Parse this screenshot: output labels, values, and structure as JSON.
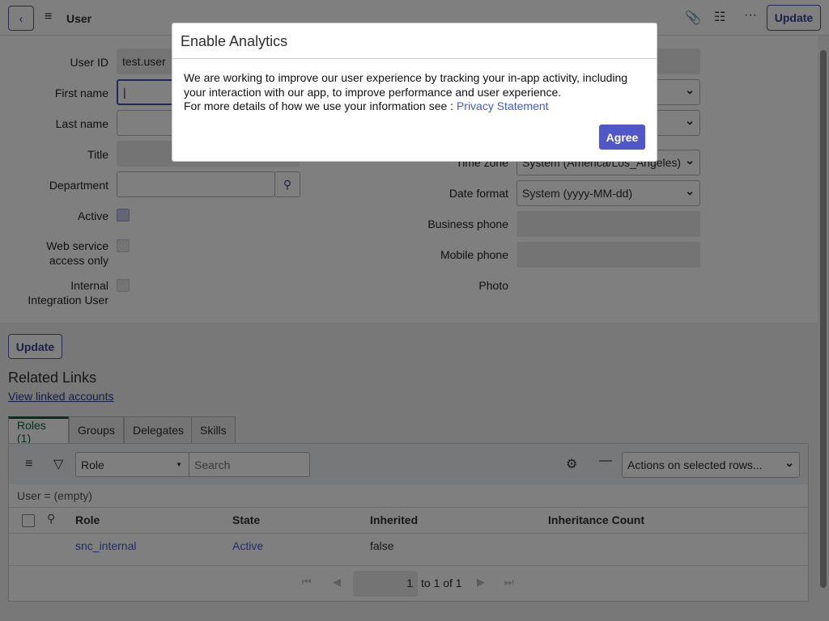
{
  "header": {
    "title": "User",
    "update_label": "Update"
  },
  "form": {
    "user_id_label": "User ID",
    "user_id_value": "test.user",
    "first_name_label": "First name",
    "last_name_label": "Last name",
    "title_label": "Title",
    "department_label": "Department",
    "active_label": "Active",
    "web_service_label_1": "Web service",
    "web_service_label_2": "access only",
    "internal_label_1": "Internal",
    "internal_label_2": "Integration User",
    "time_zone_label": "Time zone",
    "time_zone_value": "System (America/Los_Angeles)",
    "date_format_label": "Date format",
    "date_format_value": "System (yyyy-MM-dd)",
    "business_phone_label": "Business phone",
    "mobile_phone_label": "Mobile phone",
    "photo_label": "Photo"
  },
  "lower": {
    "update_label": "Update",
    "related_links": "Related Links",
    "view_linked": "View linked accounts",
    "tabs": [
      {
        "label": "Roles (1)"
      },
      {
        "label": "Groups"
      },
      {
        "label": "Delegates"
      },
      {
        "label": "Skills"
      }
    ],
    "filter_field": "Role",
    "search_placeholder": "Search",
    "actions": "Actions on selected rows...",
    "breadcrumb": "User = (empty)",
    "columns": [
      "Role",
      "State",
      "Inherited",
      "Inheritance Count"
    ],
    "rows": [
      {
        "role": "snc_internal",
        "state": "Active",
        "inherited": "false",
        "count": ""
      }
    ],
    "pager": {
      "page": "1",
      "range": "to 1 of 1"
    }
  },
  "dialog": {
    "title": "Enable Analytics",
    "line1": "We are working to improve our user experience by tracking your in-app activity, including your interaction with our app, to improve performance and user experience.",
    "line2": "For more details of how we use your information see : ",
    "link": "Privacy Statement",
    "agree": "Agree",
    "agree_color": "#5257c7"
  }
}
